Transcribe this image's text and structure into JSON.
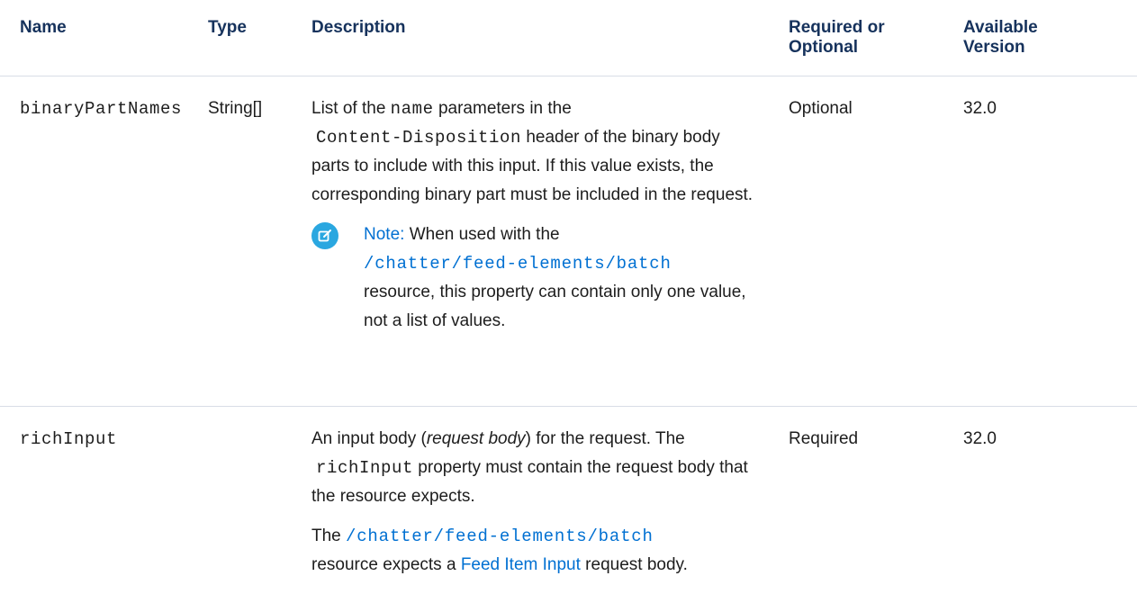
{
  "headers": {
    "name": "Name",
    "type": "Type",
    "description": "Description",
    "required_line1": "Required or",
    "required_line2": "Optional",
    "version_line1": "Available",
    "version_line2": "Version"
  },
  "rows": [
    {
      "name": "binaryPartNames",
      "type": "String[]",
      "desc_1a": "List of the ",
      "desc_1_code": "name",
      "desc_1b": " parameters in the",
      "desc_1_code2": "Content-Disposition",
      "desc_1c": " header of the binary body parts to include with this input. If this value exists, the corresponding binary part must be included in the request.",
      "note_label": "Note:",
      "note_a": " When used with the",
      "note_link": "/chatter/feed-elements/batch",
      "note_b": "resource, this property can contain only one value, not a list of values.",
      "required": "Optional",
      "version": "32.0"
    },
    {
      "name": "richInput",
      "type": "",
      "desc_a": "An input body (",
      "desc_em": "request body",
      "desc_b": ") for the request. The",
      "desc_code": "richInput",
      "desc_c": " property must contain the request body that the resource expects.",
      "desc2_a": "The ",
      "desc2_link": "/chatter/feed-elements/batch",
      "desc2_b": "resource expects a ",
      "desc2_link2": "Feed Item Input",
      "desc2_c": " request body.",
      "required": "Required",
      "version": "32.0"
    }
  ],
  "colors": {
    "header_text": "#16325c",
    "link": "#0070d2",
    "note_icon_bg": "#2aa7e0",
    "divider": "#d8dde6"
  },
  "icons": {
    "note": "edit-note-icon"
  }
}
